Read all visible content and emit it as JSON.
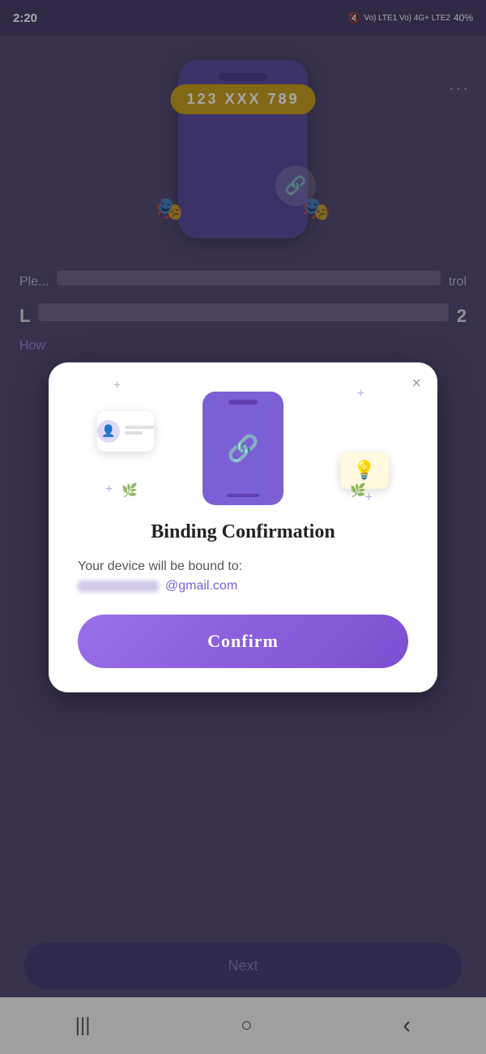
{
  "statusBar": {
    "time": "2:20",
    "battery": "40%",
    "networkInfo": "Vo) LTE1 Vo) 4G+ LTE2"
  },
  "background": {
    "phoneNumber": "123 XXX 789",
    "moreDotsLabel": "···",
    "howText": "How"
  },
  "modal": {
    "title": "Binding Confirmation",
    "bodyText": "Your device will be bound to:",
    "emailSuffix": "@gmail.com",
    "confirmLabel": "Confirm",
    "closeLabel": "×"
  },
  "bottom": {
    "nextLabel": "Next"
  },
  "nav": {
    "backIcon": "‹",
    "homeIcon": "○",
    "recentIcon": "|||"
  }
}
